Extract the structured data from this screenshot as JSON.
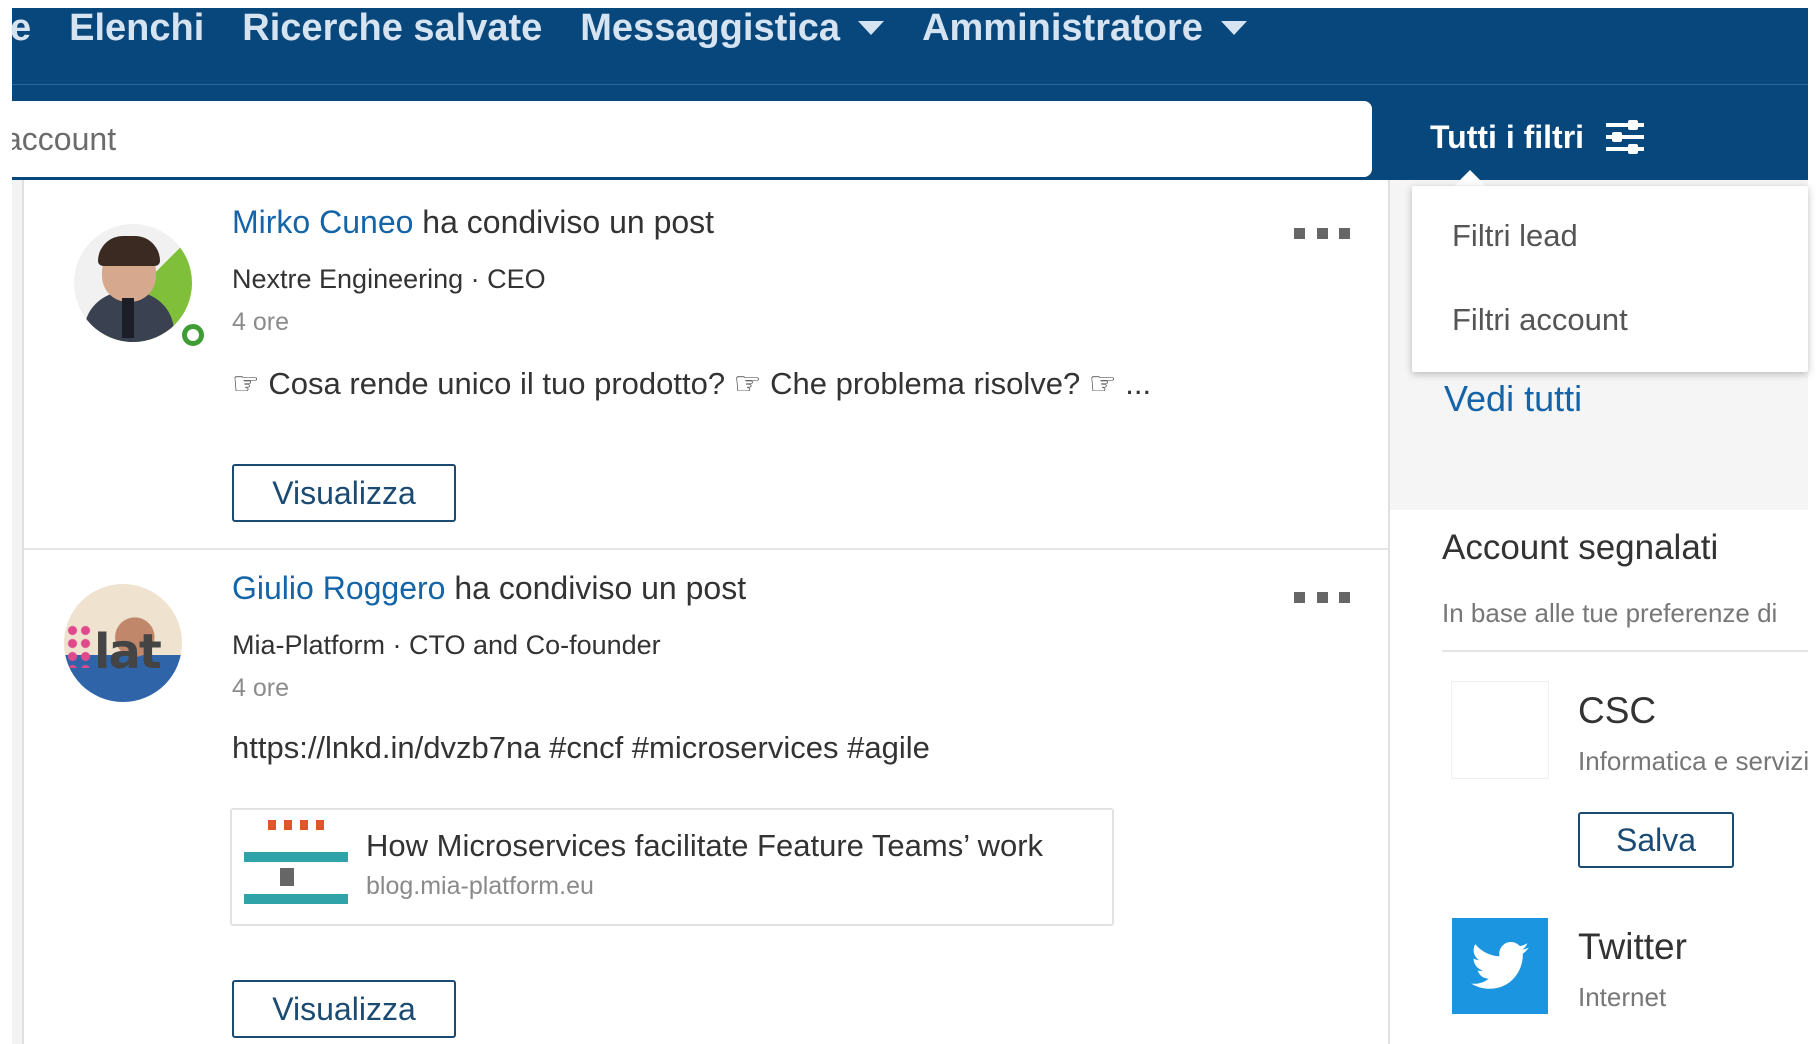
{
  "nav": {
    "items": [
      {
        "label": "e"
      },
      {
        "label": "Elenchi"
      },
      {
        "label": "Ricerche salvate"
      },
      {
        "label": "Messaggistica"
      },
      {
        "label": "Amministratore"
      }
    ]
  },
  "search": {
    "placeholder": "account",
    "filters_label": "Tutti i filtri"
  },
  "dropdown": {
    "items": [
      "Filtri lead",
      "Filtri account"
    ]
  },
  "feed": {
    "posts": [
      {
        "name": "Mirko Cuneo",
        "action": " ha condiviso un post",
        "subtitle": "Nextre Engineering · CEO",
        "time": "4 ore",
        "text": "☞ Cosa rende unico il tuo prodotto? ☞ Che problema risolve? ☞ ...",
        "button": "Visualizza"
      },
      {
        "name": "Giulio Roggero",
        "action": " ha condiviso un post",
        "subtitle": "Mia-Platform · CTO and Co-founder",
        "time": "4 ore",
        "text": "https://lnkd.in/dvzb7na #cncf #microservices #agile",
        "link_title": "How Microservices facilitate Feature Teams’ work",
        "link_domain": "blog.mia-platform.eu",
        "button": "Visualizza"
      }
    ]
  },
  "sidebar": {
    "see_all": "Vedi tutti",
    "title": "Account segnalati",
    "subtitle": "In base alle tue preferenze di",
    "companies": [
      {
        "name": "CSC",
        "industry": "Informatica e servizi",
        "button": "Salva"
      },
      {
        "name": "Twitter",
        "industry": "Internet"
      }
    ]
  },
  "colors": {
    "nav_bg": "#08477c",
    "link": "#1464a7",
    "online": "#3e9e35",
    "twitter": "#1b95e0"
  }
}
